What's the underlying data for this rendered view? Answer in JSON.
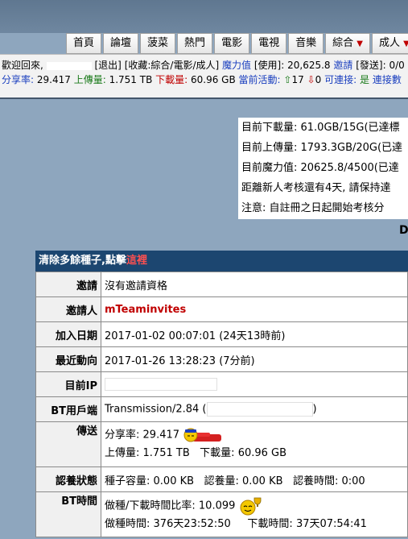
{
  "nav": {
    "items": [
      "首頁",
      "論壇",
      "菠菜",
      "熱門",
      "電影",
      "電視",
      "音樂",
      "綜合",
      "成人"
    ]
  },
  "infobar": {
    "welcome": "歡迎回來,",
    "logout": "[退出]",
    "fav_prefix": "[收藏:",
    "fav_items": "綜合/電影/成人",
    "fav_suffix": "]",
    "magic_label": "魔力值",
    "use_label": "[使用]:",
    "magic_value": "20,625.8",
    "invite_label": "邀請",
    "sent_label": "[發送]:",
    "invite_value": "0/0",
    "ratio_label": "分享率:",
    "ratio_value": "29.417",
    "upload_label": "上傳量:",
    "upload_value": "1.751 TB",
    "download_label": "下載量:",
    "download_value": "60.96 GB",
    "active_label": "當前活動:",
    "seeding": "17",
    "leeching": "0",
    "connectable_label": "可連接:",
    "connectable_value": "是",
    "conn_count_label": "連接數"
  },
  "status_box": {
    "lines": [
      "目前下載量: 61.0GB/15G(已達標",
      "目前上傳量: 1793.3GB/20G(已達",
      "目前魔力值: 20625.8/4500(已達",
      "距離新人考核還有4天, 請保持達",
      "注意: 自註冊之日起開始考核分"
    ]
  },
  "d_letter": "D",
  "panel": {
    "header_text": "清除多餘種子,點擊",
    "header_link": "這裡",
    "rows": {
      "invite": {
        "label": "邀請",
        "value": "沒有邀請資格"
      },
      "inviter": {
        "label": "邀請人",
        "value": "mTeaminvites"
      },
      "joined": {
        "label": "加入日期",
        "value": "2017-01-02 00:07:01 (24天13時前)"
      },
      "recent": {
        "label": "最近動向",
        "value": "2017-01-26 13:28:23 (7分前)"
      },
      "ip": {
        "label": "目前IP"
      },
      "client": {
        "label": "BT用戶端",
        "prefix": "Transmission/2.84 (",
        "suffix": ")"
      },
      "transfer": {
        "label": "傳送",
        "ratio_label": "分享率:",
        "ratio": "29.417",
        "up_label": "上傳量:",
        "up": "1.751 TB",
        "down_label": "下載量:",
        "down": "60.96 GB"
      },
      "adoption": {
        "label": "認養狀態",
        "size_label": "種子容量:",
        "size": "0.00 KB",
        "amount_label": "認養量:",
        "amount": "0.00 KB",
        "time_label": "認養時間:",
        "time": "0:00"
      },
      "bt_time": {
        "label": "BT時間",
        "ratio_label": "做種/下載時間比率:",
        "ratio": "10.099",
        "seed_label": "做種時間:",
        "seed": "376天23:52:50",
        "dl_label": "下載時間:",
        "dl": "37天07:54:41"
      }
    }
  },
  "colors": {
    "page_bg": "#8ea6be",
    "panel_header": "#1c4670",
    "accent_red": "#c00000",
    "link_blue": "#1a3fbf"
  }
}
